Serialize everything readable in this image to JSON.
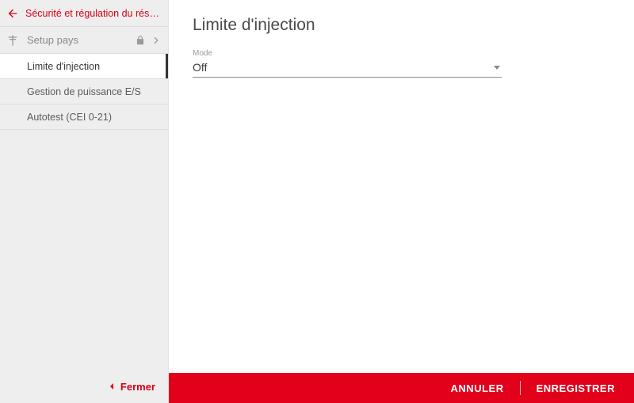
{
  "sidebar": {
    "header_title": "Sécurité et régulation du réseau",
    "top_label": "Setup pays",
    "items": [
      {
        "label": "Limite d'injection",
        "active": true
      },
      {
        "label": "Gestion de puissance E/S",
        "active": false
      },
      {
        "label": "Autotest (CEI 0-21)",
        "active": false
      }
    ],
    "close_label": "Fermer"
  },
  "main": {
    "title": "Limite d'injection",
    "mode_label": "Mode",
    "mode_value": "Off"
  },
  "actions": {
    "cancel": "ANNULER",
    "save": "ENREGISTRER"
  }
}
